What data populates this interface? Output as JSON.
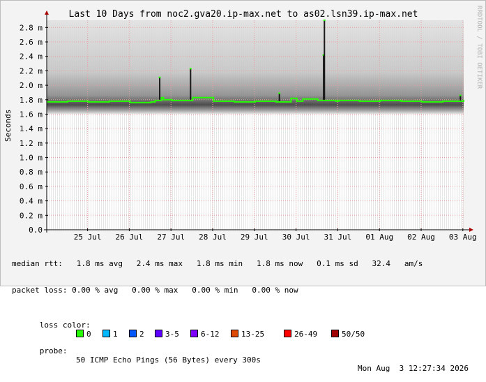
{
  "chart_data": {
    "type": "area",
    "title": "Last 10 Days from noc2.gva20.ip-max.net to as02.lsn39.ip-max.net",
    "ylabel": "Seconds",
    "side_label": "RRDTOOL / TOBI OETIKER",
    "ylim": [
      0,
      0.0029
    ],
    "yticks": [
      {
        "v": 0.0,
        "label": "0.0"
      },
      {
        "v": 0.0002,
        "label": "0.2 m"
      },
      {
        "v": 0.0004,
        "label": "0.4 m"
      },
      {
        "v": 0.0006,
        "label": "0.6 m"
      },
      {
        "v": 0.0008,
        "label": "0.8 m"
      },
      {
        "v": 0.001,
        "label": "1.0 m"
      },
      {
        "v": 0.0012,
        "label": "1.2 m"
      },
      {
        "v": 0.0014,
        "label": "1.4 m"
      },
      {
        "v": 0.0016,
        "label": "1.6 m"
      },
      {
        "v": 0.0018,
        "label": "1.8 m"
      },
      {
        "v": 0.002,
        "label": "2.0 m"
      },
      {
        "v": 0.0022,
        "label": "2.2 m"
      },
      {
        "v": 0.0024,
        "label": "2.4 m"
      },
      {
        "v": 0.0026,
        "label": "2.6 m"
      },
      {
        "v": 0.0028,
        "label": "2.8 m"
      }
    ],
    "xlim": [
      0,
      10
    ],
    "xticks": [
      {
        "v": 0.98,
        "label": "25 Jul"
      },
      {
        "v": 1.98,
        "label": "26 Jul"
      },
      {
        "v": 2.98,
        "label": "27 Jul"
      },
      {
        "v": 3.98,
        "label": "28 Jul"
      },
      {
        "v": 4.98,
        "label": "29 Jul"
      },
      {
        "v": 5.98,
        "label": "30 Jul"
      },
      {
        "v": 6.98,
        "label": "31 Jul"
      },
      {
        "v": 7.98,
        "label": "01 Aug"
      },
      {
        "v": 8.98,
        "label": "02 Aug"
      },
      {
        "v": 9.98,
        "label": "03 Aug"
      }
    ],
    "median_series": {
      "name": "median rtt",
      "x": [
        0,
        0.5,
        1,
        1.5,
        2,
        2.5,
        2.6,
        2.75,
        2.8,
        3,
        3.45,
        3.5,
        4,
        4.5,
        5,
        5.5,
        5.86,
        6,
        6.14,
        6.5,
        6.94,
        7,
        7.5,
        8,
        8.5,
        9,
        9.5,
        10
      ],
      "y": [
        0.00177,
        0.00178,
        0.00177,
        0.00178,
        0.00176,
        0.00177,
        0.00179,
        0.00183,
        0.0018,
        0.00179,
        0.00179,
        0.00183,
        0.00178,
        0.00177,
        0.00178,
        0.00177,
        0.00182,
        0.00178,
        0.00181,
        0.00179,
        0.00178,
        0.00179,
        0.00178,
        0.00179,
        0.00178,
        0.00177,
        0.00178,
        0.0018
      ]
    },
    "smoke_band": {
      "low": 0.0016,
      "high": 0.0029
    },
    "spikes": [
      {
        "x": 2.71,
        "y": 0.00211
      },
      {
        "x": 3.45,
        "y": 0.00223
      },
      {
        "x": 5.58,
        "y": 0.00189
      },
      {
        "x": 6.64,
        "y": 0.00242
      },
      {
        "x": 6.66,
        "y": 0.0029
      },
      {
        "x": 9.92,
        "y": 0.00186
      }
    ]
  },
  "stats": {
    "median_rtt": "median rtt:   1.8 ms avg   2.4 ms max   1.8 ms min   1.8 ms now   0.1 ms sd   32.4   am/s",
    "packet_loss": "packet loss: 0.00 % avg   0.00 % max   0.00 % min   0.00 % now",
    "loss_color_label": "loss color:",
    "probe_label": "probe:",
    "probe_text": "50 ICMP Echo Pings (56 Bytes) every 300s",
    "timestamp": "Mon Aug  3 12:27:34 2026"
  },
  "loss_colors": [
    {
      "label": "0",
      "color": "#26ff00"
    },
    {
      "label": "1",
      "color": "#00b8ff"
    },
    {
      "label": "2",
      "color": "#0059ff"
    },
    {
      "label": "3-5",
      "color": "#5e00ff"
    },
    {
      "label": "6-12",
      "color": "#7e00ff"
    },
    {
      "label": "13-25",
      "color": "#dd4a00"
    },
    {
      "label": "26-49",
      "color": "#ff0000"
    },
    {
      "label": "50/50",
      "color": "#a10000"
    }
  ],
  "colors": {
    "median": "#26ff00",
    "grid": "#e8a0a0",
    "axis": "#000000"
  }
}
